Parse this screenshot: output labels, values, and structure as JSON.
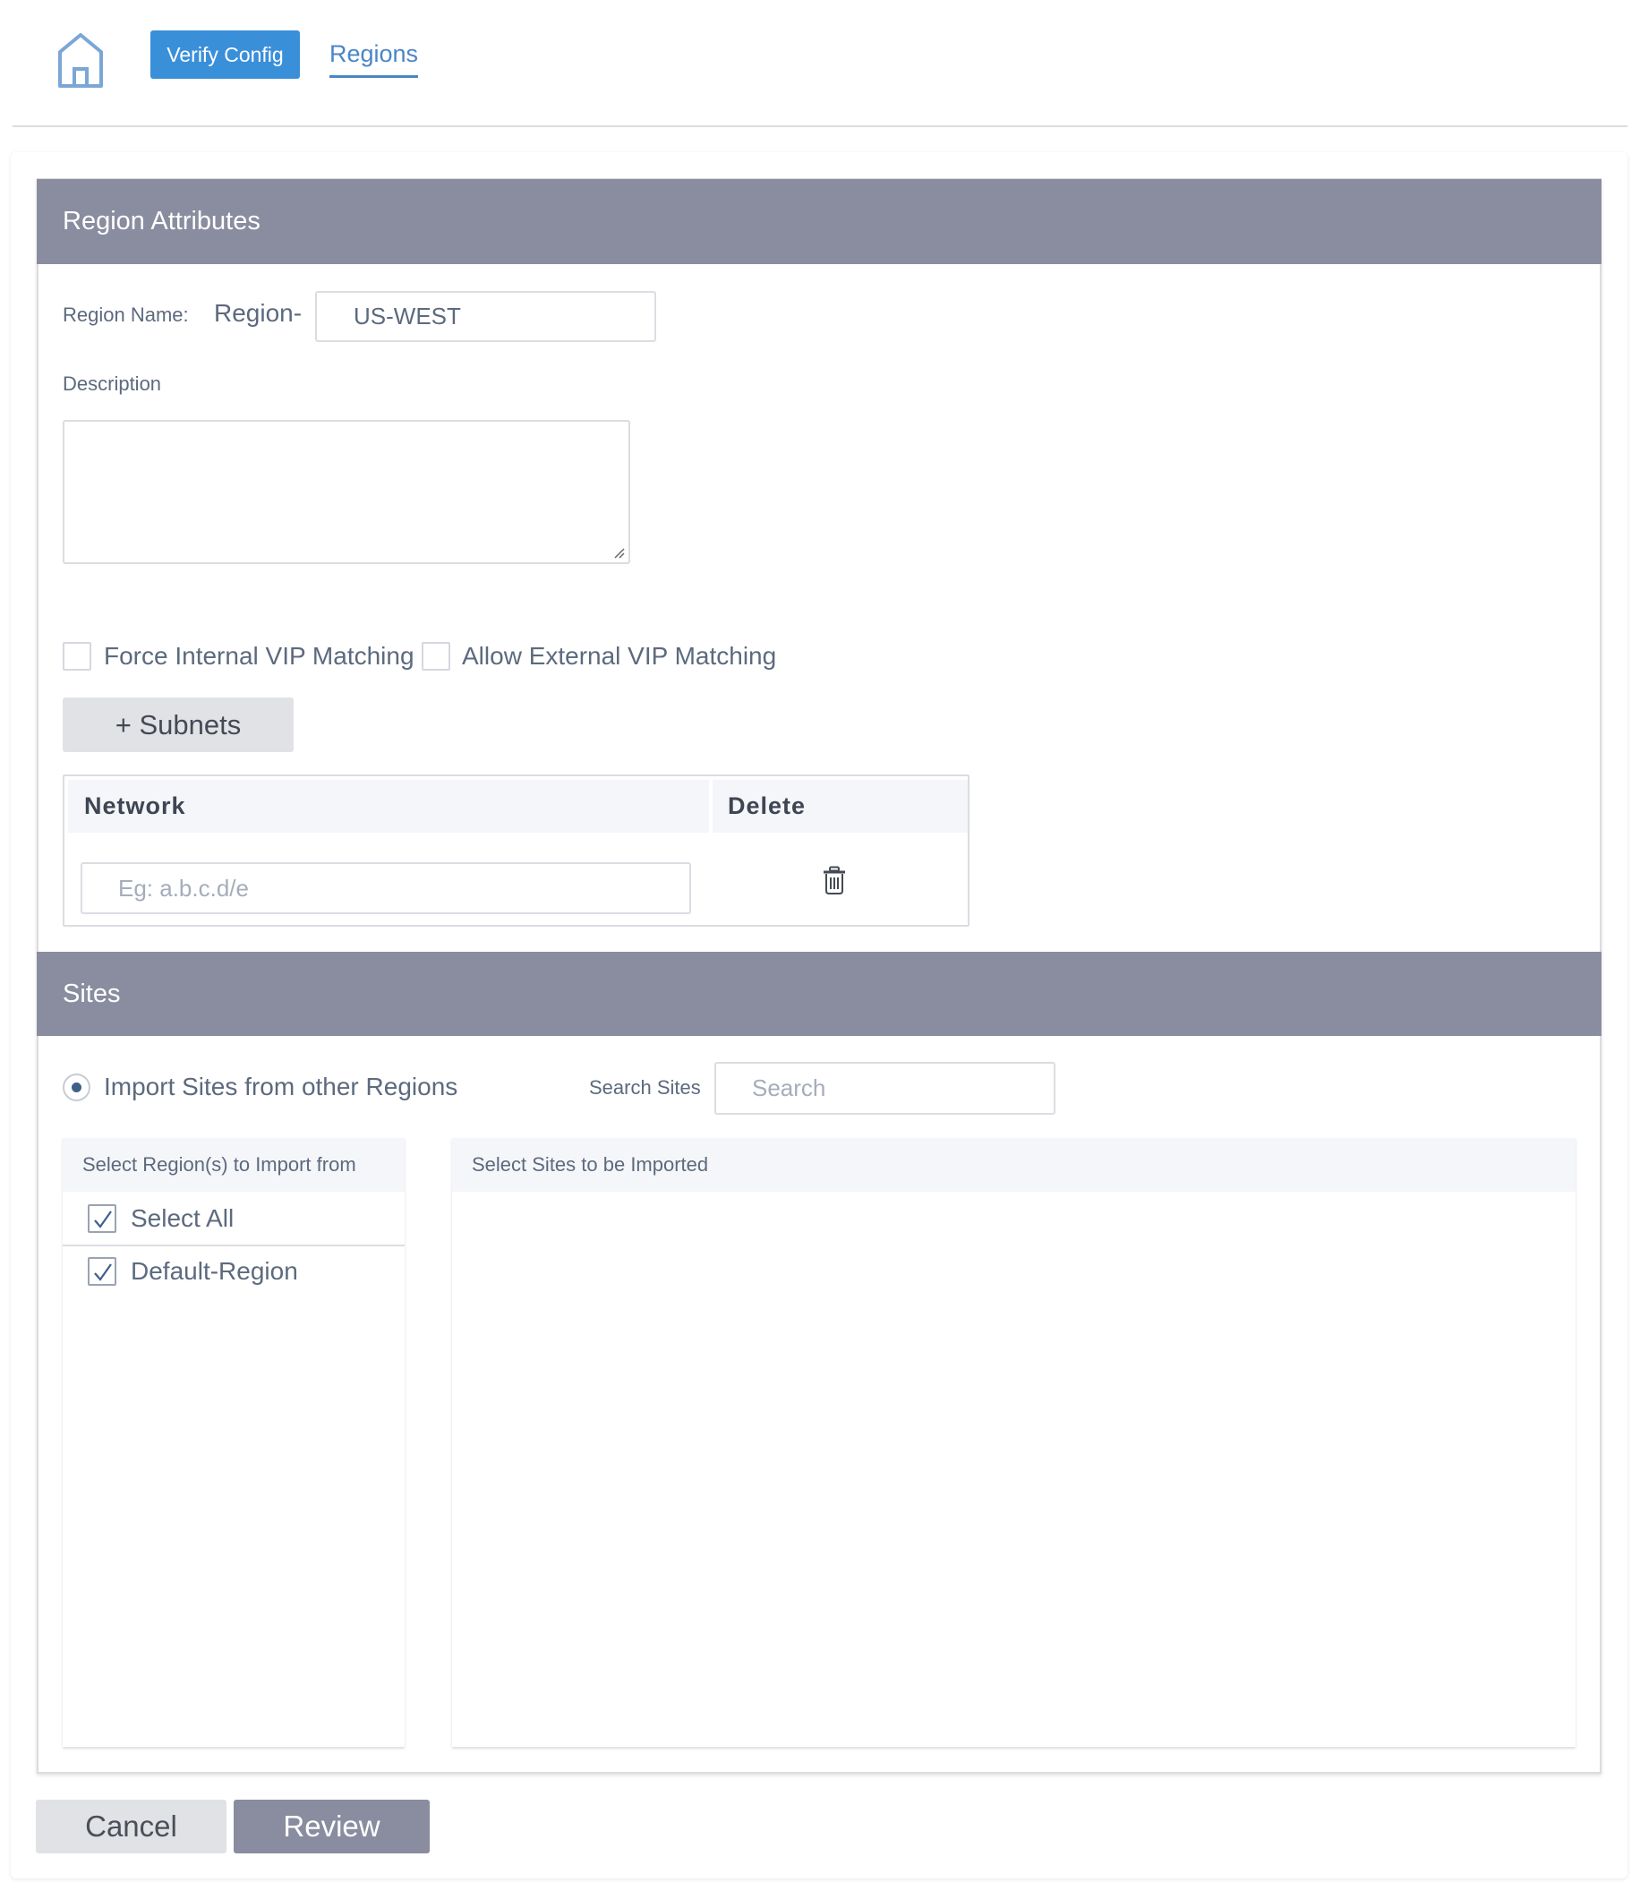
{
  "nav": {
    "home_icon": "home-icon",
    "verify_config_label": "Verify Config",
    "active_tab_label": "Regions"
  },
  "region_attributes": {
    "title": "Region Attributes",
    "region_name_label": "Region Name:",
    "region_prefix": "Region-",
    "region_name_value": "US-WEST",
    "description_label": "Description",
    "description_value": "",
    "force_internal_vip": {
      "label": "Force Internal VIP Matching",
      "checked": false
    },
    "allow_external_vip": {
      "label": "Allow External VIP Matching",
      "checked": false
    },
    "add_subnets_label": "+ Subnets",
    "subnet_table": {
      "columns": [
        "Network",
        "Delete"
      ],
      "rows": [
        {
          "network_value": "",
          "network_placeholder": "Eg: a.b.c.d/e",
          "delete_icon": "trash-icon"
        }
      ]
    }
  },
  "sites": {
    "title": "Sites",
    "import_option_label": "Import Sites from other Regions",
    "import_option_selected": true,
    "search_label": "Search Sites",
    "search_placeholder": "Search",
    "search_value": "",
    "regions_panel": {
      "header": "Select Region(s) to Import from",
      "items": [
        {
          "label": "Select All",
          "checked": true
        },
        {
          "label": "Default-Region",
          "checked": true
        }
      ]
    },
    "sites_panel": {
      "header": "Select Sites to be Imported",
      "items": []
    }
  },
  "footer": {
    "cancel_label": "Cancel",
    "review_label": "Review"
  },
  "colors": {
    "primary_blue": "#3a8fd9",
    "link_blue": "#4a86c5",
    "section_header": "#8a8d9f",
    "secondary_button": "#e1e2e5"
  }
}
